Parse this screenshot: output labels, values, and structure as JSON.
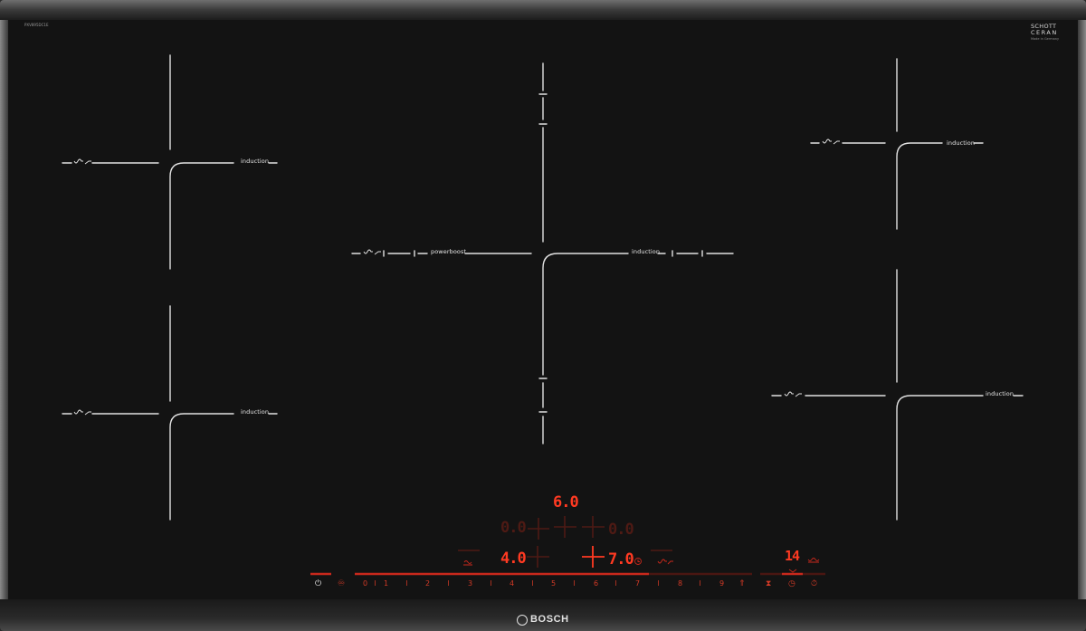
{
  "model_code": "PXV895DC1E",
  "certification": {
    "line1": "SCHOTT",
    "line2": "CERAN",
    "line3": "Made in Germany"
  },
  "brand": "BOSCH",
  "zones": {
    "front_left": {
      "label": "induction"
    },
    "rear_left": {
      "label": "induction"
    },
    "center_left": {
      "label": "powerboost"
    },
    "center_right": {
      "label": "induction"
    },
    "rear_right": {
      "label": "induction"
    },
    "front_right": {
      "label": "induction"
    }
  },
  "display": {
    "top_level": "6.0",
    "left_inactive": "0.0",
    "right_inactive": "0.0",
    "left_level": "4.0",
    "right_level": "7.0",
    "timer_minutes": "14"
  },
  "power_scale": [
    "0",
    "1",
    "2",
    "3",
    "4",
    "5",
    "6",
    "7",
    "8",
    "9"
  ],
  "icons": {
    "power": "power-icon",
    "child_lock": "child-lock-icon",
    "powerboost": "powerboost-icon",
    "flex_zone": "flex-zone-icon",
    "keep_warm": "keep-warm-icon",
    "timer": "timer-icon",
    "stopwatch": "stopwatch-icon",
    "wipe_protection": "wipe-protection-icon",
    "info": "info-icon"
  },
  "colors": {
    "active_red": "#ff3a22",
    "dim_red": "#4e1a14",
    "glass": "#131313",
    "print": "#e8e8e8"
  }
}
